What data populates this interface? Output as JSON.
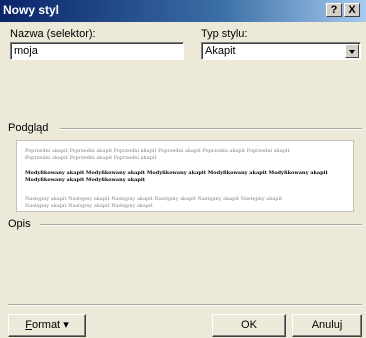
{
  "window": {
    "title": "Nowy styl",
    "help_label": "?",
    "close_label": "X"
  },
  "fields": {
    "name_label": "Nazwa (selektor):",
    "name_value": "moja",
    "type_label": "Typ stylu:",
    "type_value": "Akapit"
  },
  "groups": {
    "preview": "Podgląd",
    "description": "Opis"
  },
  "preview": {
    "previous_lines": [
      "Poprzedni akapit Poprzedni akapit Poprzedni akapit Poprzedni akapit Poprzedni akapit Poprzedni akapit",
      "Poprzedni akapit Poprzedni akapit Poprzedni akapit"
    ],
    "current_lines": [
      "Modyfikowany akapit Modyfikowany akapit Modyfikowany akapit Modyfikowany akapit Modyfikowany akapit",
      "Modyfikowany akapit Modyfikowany akapit"
    ],
    "next_lines": [
      "Następny akapit Następny akapit Następny akapit Następny akapit Następny akapit Następny akapit",
      "Następny akapit Następny akapit Następny akapit"
    ]
  },
  "buttons": {
    "format_prefix": "F",
    "format_rest": "ormat",
    "format_arrow": "▾",
    "ok": "OK",
    "cancel": "Anuluj"
  },
  "colors": {
    "titlebar_start": "#0a246a",
    "titlebar_end": "#a6caf0",
    "dialog_bg": "#ece9d8"
  }
}
